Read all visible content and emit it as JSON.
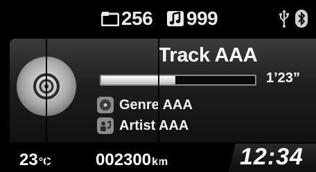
{
  "status": {
    "folder_count": "256",
    "track_count": "999",
    "icons": [
      "folder-icon",
      "music-note-icon",
      "usb-icon",
      "bluetooth-icon"
    ]
  },
  "track": {
    "title": "Track AAA",
    "elapsed": "1’23”",
    "progress_fraction": 0.48,
    "genre": "Genre AAA",
    "artist": "Artist AAA"
  },
  "footer": {
    "temperature": "23",
    "temperature_unit": "°C",
    "odometer": "002300",
    "odometer_unit": "km",
    "clock": "12:34"
  },
  "colors": {
    "background": "#000000",
    "text": "#ffffff",
    "icon_gray": "#8b8b8b"
  }
}
